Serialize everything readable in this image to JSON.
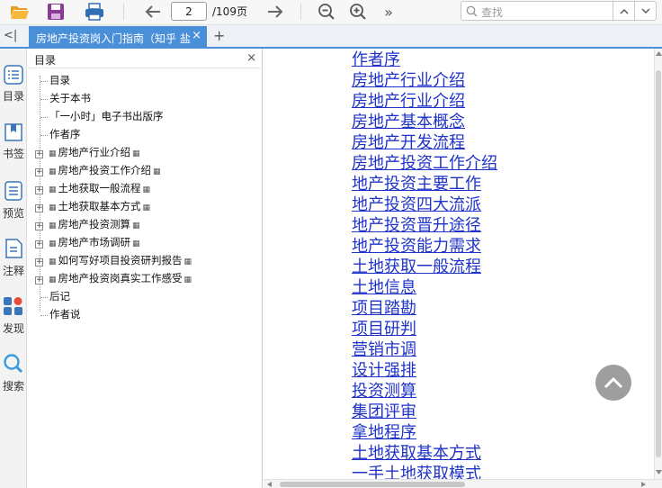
{
  "toolbar": {
    "open_icon": "folder-open-icon",
    "save_icon": "save-icon",
    "print_icon": "print-icon",
    "prev_icon": "arrow-left-icon",
    "current_page": "2",
    "total_pages": "/109页",
    "next_icon": "arrow-right-icon",
    "zoom_out_icon": "zoom-out-icon",
    "zoom_in_icon": "zoom-in-icon",
    "more_label": "»",
    "search_placeholder": "查找"
  },
  "tabbar": {
    "collapse_label": "<|",
    "tab_label": "房地产投资岗入门指南（知乎 盐",
    "tab_close": "×",
    "new_tab": "+"
  },
  "rail": [
    {
      "label": "目录",
      "icon": "toc-list-icon"
    },
    {
      "label": "书签",
      "icon": "bookmark-icon"
    },
    {
      "label": "预览",
      "icon": "preview-icon"
    },
    {
      "label": "注释",
      "icon": "note-icon"
    },
    {
      "label": "发现",
      "icon": "discover-icon"
    },
    {
      "label": "搜索",
      "icon": "search-icon"
    }
  ],
  "toc": {
    "title": "目录",
    "close": "×",
    "items": [
      {
        "label": "目录",
        "expandable": false
      },
      {
        "label": "关于本书",
        "expandable": false
      },
      {
        "label": "「一小时」电子书出版序",
        "expandable": false
      },
      {
        "label": "作者序",
        "expandable": false
      },
      {
        "label": "房地产行业介绍",
        "expandable": true
      },
      {
        "label": "房地产投资工作介绍",
        "expandable": true
      },
      {
        "label": "土地获取一般流程",
        "expandable": true
      },
      {
        "label": "土地获取基本方式",
        "expandable": true
      },
      {
        "label": "房地产投资测算",
        "expandable": true
      },
      {
        "label": "房地产市场调研",
        "expandable": true
      },
      {
        "label": "如何写好项目投资研判报告",
        "expandable": true
      },
      {
        "label": "房地产投资岗真实工作感受",
        "expandable": true
      },
      {
        "label": "后记",
        "expandable": false
      },
      {
        "label": "作者说",
        "expandable": false
      }
    ]
  },
  "page_links": [
    "作者序",
    "房地产行业介绍",
    "房地产行业介绍",
    "房地产基本概念",
    "房地产开发流程",
    "房地产投资工作介绍",
    "地产投资主要工作",
    "地产投资四大流派",
    "地产投资晋升途径",
    "地产投资能力需求",
    "土地获取一般流程",
    "土地信息",
    "项目踏勘",
    "项目研判",
    "营销市调",
    "设计强排",
    "投资测算",
    "集团评审",
    "拿地程序",
    "土地获取基本方式",
    "一手土地获取模式"
  ],
  "colors": {
    "accent": "#4a90d9",
    "link": "#1f33c8"
  }
}
